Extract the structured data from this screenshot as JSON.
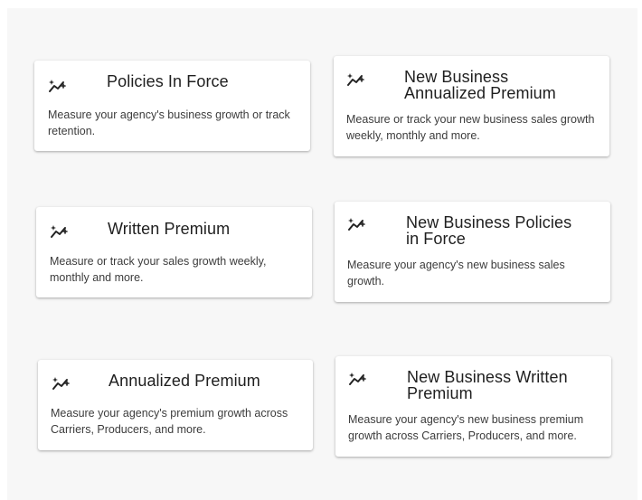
{
  "cards": [
    {
      "title": "Policies In Force",
      "description": "Measure your agency's business growth or track retention.",
      "icon": "trending-sparkle-icon"
    },
    {
      "title": "New Business Annualized Premium",
      "description": "Measure or track your new business sales growth weekly, monthly and more.",
      "icon": "trending-sparkle-icon"
    },
    {
      "title": "Written Premium",
      "description": "Measure or track your sales growth weekly, monthly and more.",
      "icon": "trending-sparkle-icon"
    },
    {
      "title": "New Business Policies in Force",
      "description": "Measure your agency's new business sales growth.",
      "icon": "trending-sparkle-icon"
    },
    {
      "title": "Annualized Premium",
      "description": "Measure your agency's premium growth across Carriers, Producers, and more.",
      "icon": "trending-sparkle-icon"
    },
    {
      "title": "New Business Written Premium",
      "description": "Measure your agency's new business premium growth across Carriers, Producers, and more.",
      "icon": "trending-sparkle-icon"
    }
  ]
}
